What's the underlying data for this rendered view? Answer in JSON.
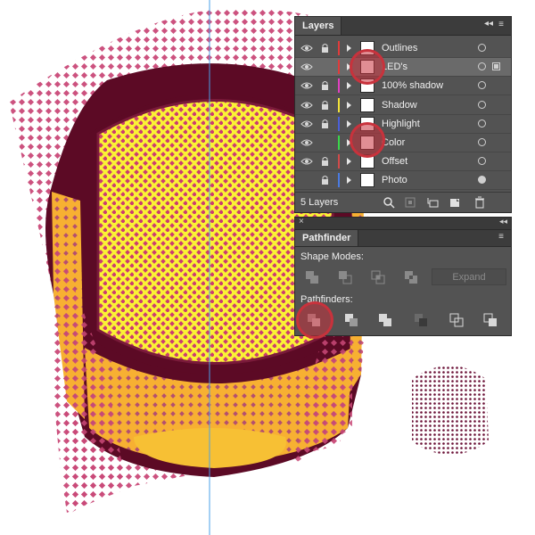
{
  "artwork": {
    "description_icon": "scarab-beetle-led-mesh-icon",
    "colors": {
      "mesh_magenta": "#cc3d70",
      "mesh_yellow": "#fbf235",
      "orange": "#f7b032",
      "dark_maroon": "#5c0a25",
      "guide_blue": "#4aa0e8"
    }
  },
  "layers_panel": {
    "tab_label": "Layers",
    "menu_icon": "panel-menu-icon",
    "layers": [
      {
        "name": "Outlines",
        "color": "#e03b3b",
        "visible": true,
        "locked": true,
        "selected": false,
        "target_filled": false
      },
      {
        "name": "LED's",
        "color": "#e03b3b",
        "visible": true,
        "locked": false,
        "selected": true,
        "target_filled": false
      },
      {
        "name": "100% shadow",
        "color": "#e040c0",
        "visible": true,
        "locked": true,
        "selected": false,
        "target_filled": false
      },
      {
        "name": "Shadow",
        "color": "#f2e23a",
        "visible": true,
        "locked": true,
        "selected": false,
        "target_filled": false
      },
      {
        "name": "Highlight",
        "color": "#4a5fd8",
        "visible": true,
        "locked": true,
        "selected": false,
        "target_filled": false
      },
      {
        "name": "Color",
        "color": "#3ad64a",
        "visible": true,
        "locked": false,
        "selected": false,
        "target_filled": false
      },
      {
        "name": "Offset",
        "color": "#d04a4a",
        "visible": true,
        "locked": true,
        "selected": false,
        "target_filled": false
      },
      {
        "name": "Photo",
        "color": "#4a7ae0",
        "visible": false,
        "locked": true,
        "selected": false,
        "target_filled": true
      }
    ],
    "footer_count": "5 Layers"
  },
  "pathfinder_panel": {
    "tab_label": "Pathfinder",
    "shape_modes_label": "Shape Modes:",
    "expand_label": "Expand",
    "pathfinders_label": "Pathfinders:",
    "shape_mode_icons": [
      "unite-icon",
      "minus-front-icon",
      "intersect-icon",
      "exclude-icon"
    ],
    "pathfinder_icons": [
      "divide-icon",
      "trim-icon",
      "merge-icon",
      "crop-icon",
      "outline-icon",
      "minus-back-icon"
    ]
  },
  "annotations": {
    "highlight_color": "#c8323c"
  }
}
